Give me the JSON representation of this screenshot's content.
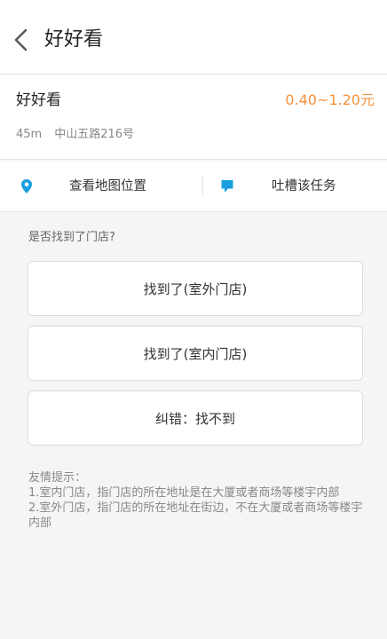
{
  "header": {
    "title": "好好看",
    "back_icon": "chevron-left-icon"
  },
  "store": {
    "name": "好好看",
    "price_range": "0.40~1.20元",
    "distance": "45m",
    "address": "中山五路216号"
  },
  "actions": {
    "map": {
      "label": "查看地图位置",
      "icon": "location-pin-icon"
    },
    "feedback": {
      "label": "吐槽该任务",
      "icon": "comment-icon"
    }
  },
  "question": "是否找到了门店?",
  "options": [
    {
      "label": "找到了(室外门店)"
    },
    {
      "label": "找到了(室内门店)"
    },
    {
      "label": "纠错：找不到"
    }
  ],
  "tips": {
    "heading": "友情提示：",
    "lines": [
      "1.室内门店，指门店的所在地址是在大厦或者商场等楼宇内部",
      "2.室外门店，指门店的所在地址在街边，不在大厦或者商场等楼宇内部"
    ]
  },
  "colors": {
    "accent": "#f5923e",
    "icon_blue": "#1a9fe0"
  }
}
